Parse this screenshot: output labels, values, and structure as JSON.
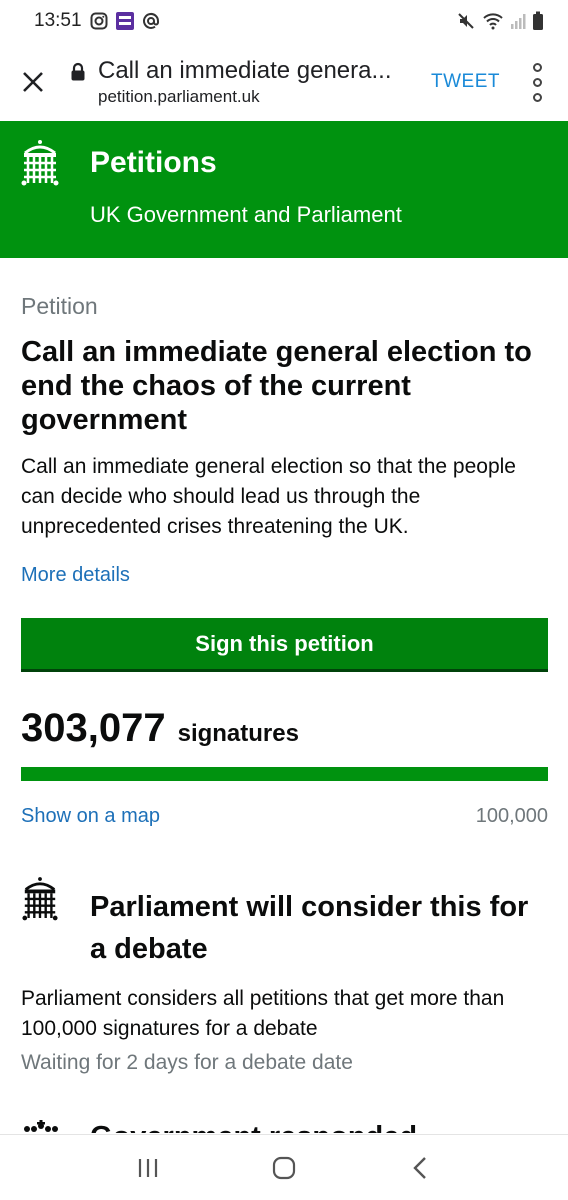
{
  "status_bar": {
    "time": "13:51",
    "icons": [
      "instagram-icon",
      "app-2020-icon",
      "at-icon",
      "mute-icon",
      "wifi-icon",
      "signal-icon",
      "battery-icon"
    ]
  },
  "browser": {
    "page_title": "Call an immediate genera...",
    "host": "petition.parliament.uk",
    "tweet_label": "TWEET"
  },
  "header": {
    "title": "Petitions",
    "subtitle": "UK Government and Parliament",
    "color": "#00920f"
  },
  "petition": {
    "kicker": "Petition",
    "title": "Call an immediate general election to end the chaos of the current government",
    "summary": "Call an immediate general election so that the people can decide who should lead us through the unprecedented crises threatening the UK.",
    "more_details": "More details",
    "sign_label": "Sign this petition",
    "signature_count": "303,077",
    "signature_label": "signatures",
    "progress_fraction": 1.0,
    "show_map": "Show on a map",
    "threshold": "100,000"
  },
  "debate": {
    "title": "Parliament will consider this for a debate",
    "text": "Parliament considers all petitions that get more than 100,000 signatures for a debate",
    "status": "Waiting for 2 days for a debate date"
  },
  "next_section": {
    "heading": "Government responded"
  },
  "colors": {
    "brand_green": "#00920f",
    "button_green": "#00820d",
    "link_blue": "#1d70b8",
    "tweet_blue": "#1a8ad8",
    "secondary_text": "#6f777b"
  }
}
